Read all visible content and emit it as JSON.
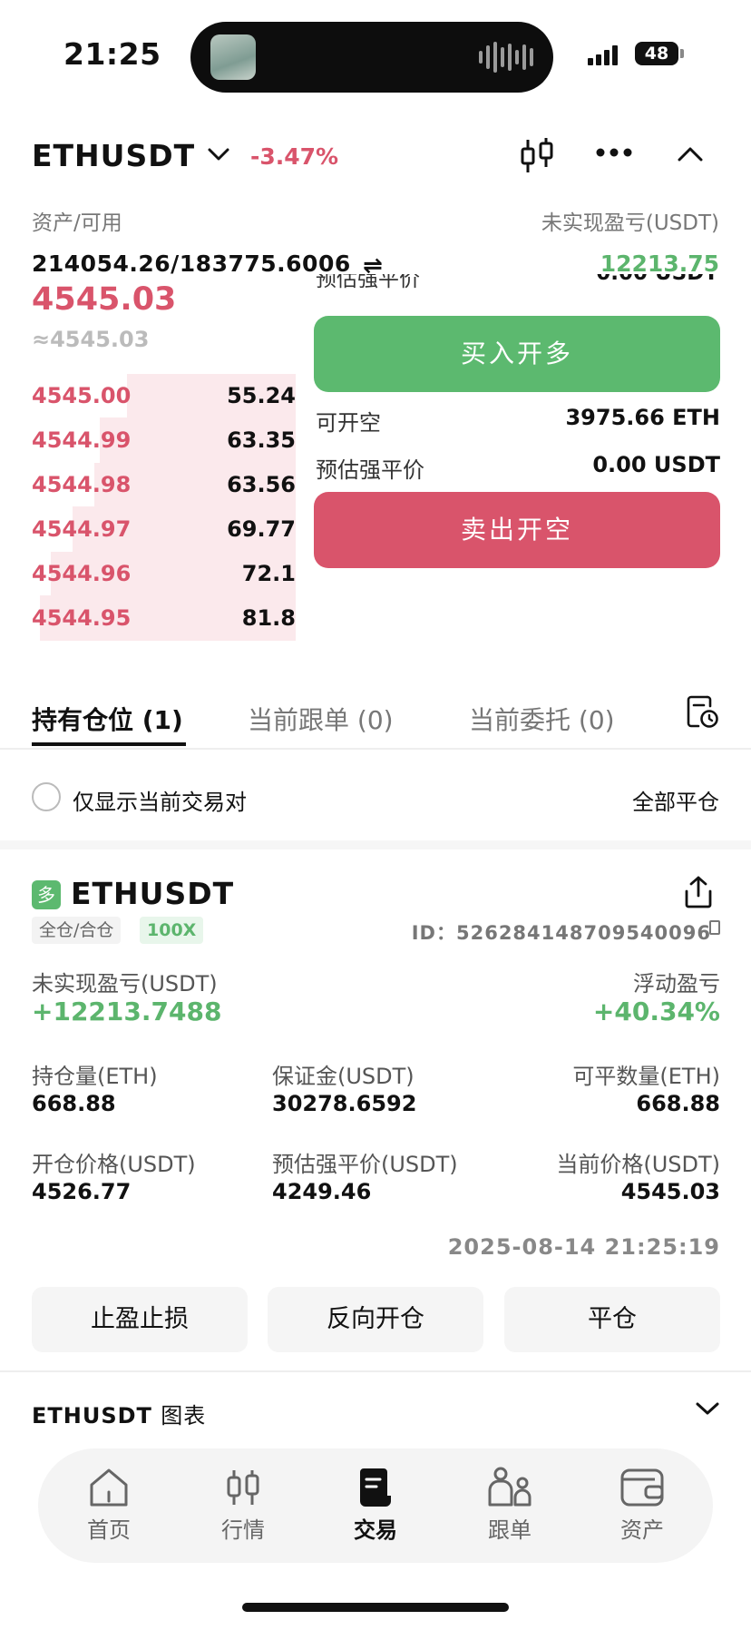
{
  "status_bar": {
    "time": "21:25",
    "battery": "48"
  },
  "header": {
    "symbol": "ETHUSDT",
    "change": "-3.47%",
    "assets_label": "资产/可用",
    "assets_value": "214054.26/183775.6006",
    "swap_icon": "⇌",
    "pnl_label": "未实现盈亏(USDT)",
    "pnl_value": "12213.75"
  },
  "ticker": {
    "last_price": "4545.03",
    "mark_price": "≈4545.03"
  },
  "order_book": [
    {
      "price": "4545.00",
      "qty": "55.24",
      "depth": 0.78
    },
    {
      "price": "4544.99",
      "qty": "63.35",
      "depth": 0.88
    },
    {
      "price": "4544.98",
      "qty": "63.56",
      "depth": 0.9
    },
    {
      "price": "4544.97",
      "qty": "69.77",
      "depth": 0.94
    },
    {
      "price": "4544.96",
      "qty": "72.1",
      "depth": 0.98
    },
    {
      "price": "4544.95",
      "qty": "81.8",
      "depth": 1.0
    }
  ],
  "order_panel": {
    "cut_label": "预估强平价",
    "cut_value": "0.00 USDT",
    "buy_long": "买入开多",
    "can_short_label": "可开空",
    "can_short_value": "3975.66 ETH",
    "liq_label": "预估强平价",
    "liq_value": "0.00 USDT",
    "sell_short": "卖出开空"
  },
  "tabs": [
    {
      "label": "持有仓位 (1)"
    },
    {
      "label": "当前跟单 (0)"
    },
    {
      "label": "当前委托 (0)"
    }
  ],
  "filter": {
    "label": "仅显示当前交易对",
    "close_all": "全部平仓"
  },
  "position": {
    "side_badge": "多",
    "symbol": "ETHUSDT",
    "mode_tag": "全仓/合仓",
    "leverage_tag": "100X",
    "id": "ID：526284148709540096",
    "upnl_label": "未实现盈亏(USDT)",
    "upnl_value": "+12213.7488",
    "roe_label": "浮动盈亏",
    "roe_value": "+40.34%",
    "size_label": "持仓量(ETH)",
    "size_value": "668.88",
    "margin_label": "保证金(USDT)",
    "margin_value": "30278.6592",
    "closable_label": "可平数量(ETH)",
    "closable_value": "668.88",
    "entry_label": "开仓价格(USDT)",
    "entry_value": "4526.77",
    "liq_label": "预估强平价(USDT)",
    "liq_value": "4249.46",
    "mark_label": "当前价格(USDT)",
    "mark_value": "4545.03",
    "timestamp": "2025-08-14 21:25:19",
    "btn_tpsl": "止盈止损",
    "btn_reverse": "反向开仓",
    "btn_close": "平仓"
  },
  "chart_section": {
    "symbol": "ETHUSDT",
    "label": "图表"
  },
  "nav": [
    {
      "label": "首页",
      "icon": "home-icon"
    },
    {
      "label": "行情",
      "icon": "market-icon"
    },
    {
      "label": "交易",
      "icon": "trade-icon"
    },
    {
      "label": "跟单",
      "icon": "copy-trade-icon"
    },
    {
      "label": "资产",
      "icon": "wallet-icon"
    }
  ],
  "colors": {
    "red": "#d9546b",
    "green": "#5cb56d",
    "buy": "#5cb96f",
    "depth": "#fbe9ec"
  }
}
